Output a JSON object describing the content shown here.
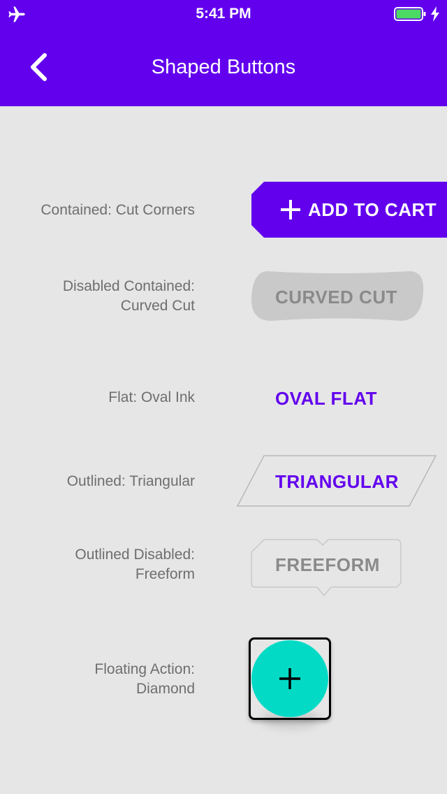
{
  "status_bar": {
    "time": "5:41 PM"
  },
  "nav": {
    "title": "Shaped Buttons"
  },
  "colors": {
    "primary": "#6200ee",
    "secondary": "#03dac6",
    "disabled_text": "#8a8a8a",
    "disabled_bg": "#c9c9c9"
  },
  "rows": {
    "contained": {
      "label": "Contained: Cut Corners",
      "button": "ADD TO CART",
      "icon": "plus-icon"
    },
    "disabled_contained": {
      "label_line1": "Disabled Contained:",
      "label_line2": "Curved Cut",
      "button": "CURVED CUT"
    },
    "flat": {
      "label": "Flat: Oval Ink",
      "button": "OVAL FLAT"
    },
    "outlined": {
      "label": "Outlined: Triangular",
      "button": "TRIANGULAR"
    },
    "outlined_disabled": {
      "label_line1": "Outlined Disabled:",
      "label_line2": "Freeform",
      "button": "FREEFORM"
    },
    "fab": {
      "label_line1": "Floating Action:",
      "label_line2": "Diamond",
      "icon": "plus-icon"
    }
  }
}
